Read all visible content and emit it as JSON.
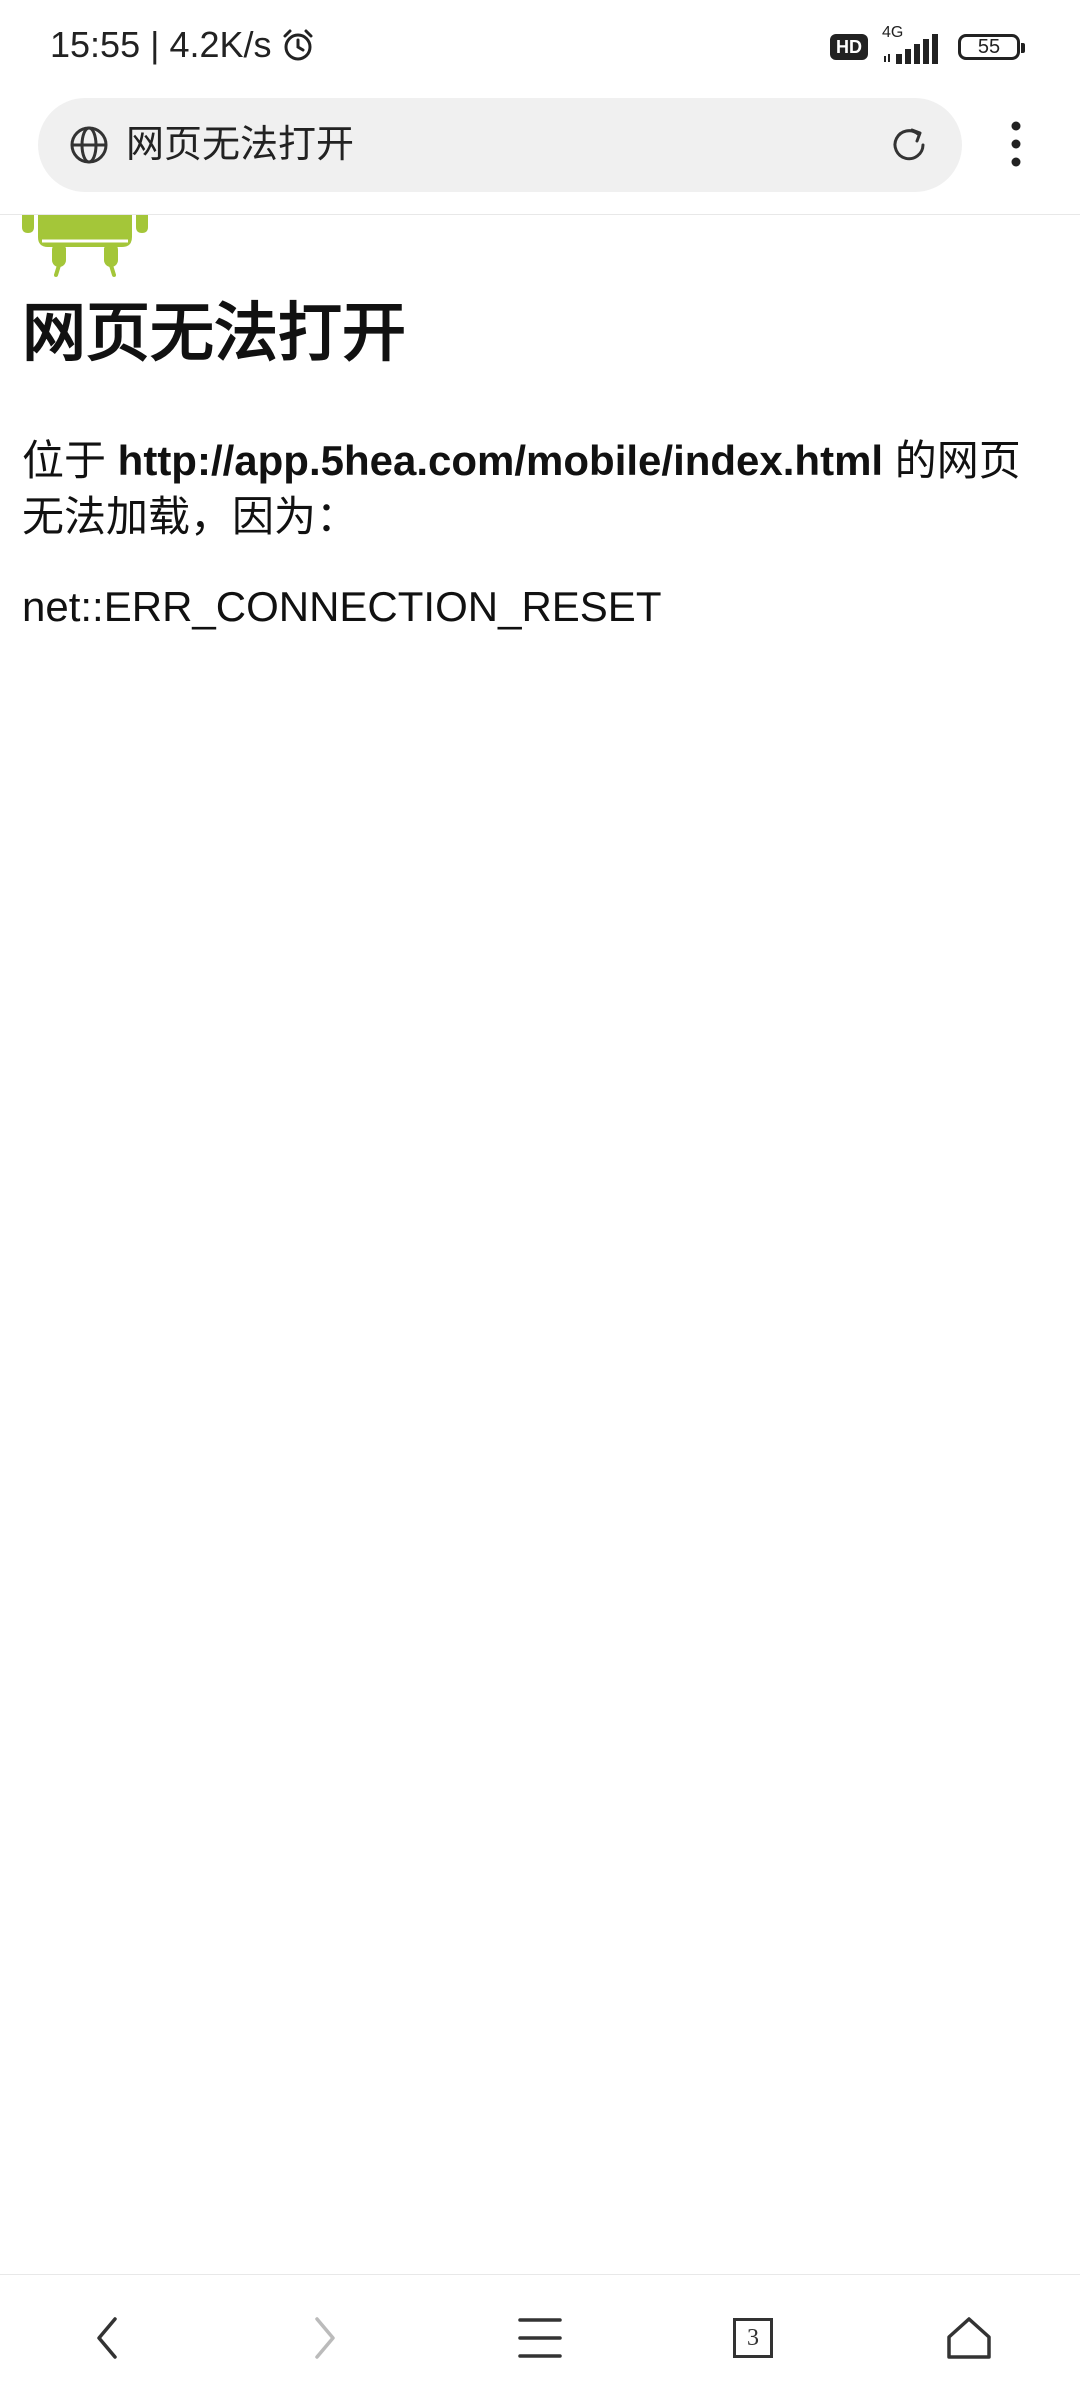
{
  "status_bar": {
    "time": "15:55",
    "separator": "|",
    "net_speed": "4.2K/s",
    "hd_label": "HD",
    "network_type": "4G",
    "battery": "55"
  },
  "address_bar": {
    "url_text": "网页无法打开"
  },
  "page": {
    "title": "网页无法打开",
    "desc_prefix": "位于 ",
    "url": "http://app.5hea.com/mobile/index.html",
    "desc_suffix": " 的网页无法加载，因为：",
    "error_code": "net::ERR_CONNECTION_RESET"
  },
  "bottom_nav": {
    "tab_count": "3"
  },
  "colors": {
    "android_green": "#A4C639",
    "pill_bg": "#F0F0F0",
    "icon": "#333333"
  },
  "icons": [
    "alarm-icon",
    "hd-icon",
    "signal-icon",
    "battery-icon",
    "globe-icon",
    "reload-icon",
    "more-menu-icon",
    "android-logo",
    "back-icon",
    "forward-icon",
    "menu-icon",
    "tabs-icon",
    "home-icon"
  ]
}
